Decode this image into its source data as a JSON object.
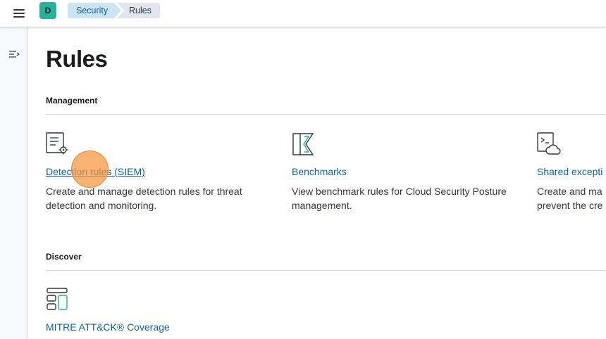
{
  "topbar": {
    "avatar_letter": "D",
    "breadcrumbs": [
      {
        "label": "Security"
      },
      {
        "label": "Rules"
      }
    ],
    "menu_icon": "hamburger-icon"
  },
  "sidenav": {
    "collapse_icon": "collapse-sidebar-icon"
  },
  "page": {
    "title": "Rules"
  },
  "management": {
    "title": "Management",
    "cards": [
      {
        "icon": "document-settings-icon",
        "link": "Detection rules (SIEM)",
        "description": "Create and manage detection rules for threat detection and monitoring."
      },
      {
        "icon": "benchmark-icon",
        "link": "Benchmarks",
        "description": "View benchmark rules for Cloud Security Posture management."
      },
      {
        "icon": "exception-list-icon",
        "link": "Shared excepti",
        "description_line1": "Create and ma",
        "description_line2": "prevent the cre"
      }
    ]
  },
  "discover": {
    "title": "Discover",
    "cards": [
      {
        "icon": "layout-grid-icon",
        "link": "MITRE ATT&CK® Coverage"
      }
    ]
  },
  "colors": {
    "accent": "#0b64a0",
    "avatar": "#24b39b",
    "breadcrumb_active_bg": "#cce4f5",
    "cursor_marker": "#f5963c"
  }
}
